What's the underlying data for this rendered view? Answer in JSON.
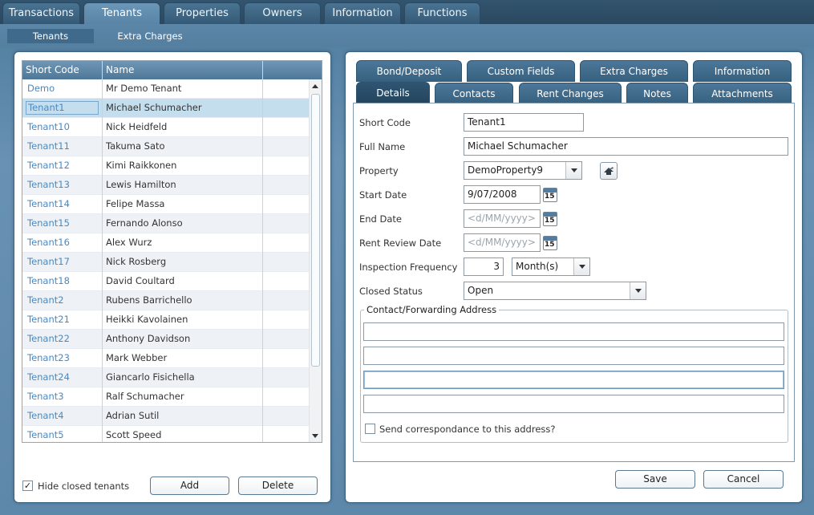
{
  "top_tabs": [
    "Transactions",
    "Tenants",
    "Properties",
    "Owners",
    "Information",
    "Functions"
  ],
  "sub_tabs": [
    "Tenants",
    "Extra Charges"
  ],
  "grid": {
    "columns": [
      "Short Code",
      "Name"
    ],
    "rows": [
      {
        "code": "Demo",
        "name": "Mr Demo Tenant"
      },
      {
        "code": "Tenant1",
        "name": "Michael Schumacher"
      },
      {
        "code": "Tenant10",
        "name": "Nick Heidfeld"
      },
      {
        "code": "Tenant11",
        "name": "Takuma Sato"
      },
      {
        "code": "Tenant12",
        "name": "Kimi Raikkonen"
      },
      {
        "code": "Tenant13",
        "name": "Lewis Hamilton"
      },
      {
        "code": "Tenant14",
        "name": "Felipe Massa"
      },
      {
        "code": "Tenant15",
        "name": "Fernando Alonso"
      },
      {
        "code": "Tenant16",
        "name": "Alex Wurz"
      },
      {
        "code": "Tenant17",
        "name": "Nick Rosberg"
      },
      {
        "code": "Tenant18",
        "name": "David Coultard"
      },
      {
        "code": "Tenant2",
        "name": "Rubens Barrichello"
      },
      {
        "code": "Tenant21",
        "name": "Heikki Kavolainen"
      },
      {
        "code": "Tenant22",
        "name": "Anthony Davidson"
      },
      {
        "code": "Tenant23",
        "name": "Mark Webber"
      },
      {
        "code": "Tenant24",
        "name": "Giancarlo Fisichella"
      },
      {
        "code": "Tenant3",
        "name": "Ralf Schumacher"
      },
      {
        "code": "Tenant4",
        "name": "Adrian Sutil"
      },
      {
        "code": "Tenant5",
        "name": "Scott Speed"
      }
    ]
  },
  "left_footer": {
    "hide_closed_label": "Hide closed tenants",
    "hide_closed_checked": true,
    "add_label": "Add",
    "delete_label": "Delete"
  },
  "detail_tabs_row1": [
    "Bond/Deposit",
    "Custom Fields",
    "Extra Charges",
    "Information"
  ],
  "detail_tabs_row2": [
    "Details",
    "Contacts",
    "Rent Changes",
    "Notes",
    "Attachments"
  ],
  "form": {
    "short_code_label": "Short Code",
    "short_code": "Tenant1",
    "full_name_label": "Full Name",
    "full_name": "Michael Schumacher",
    "property_label": "Property",
    "property": "DemoProperty9",
    "start_date_label": "Start Date",
    "start_date": "9/07/2008",
    "end_date_label": "End Date",
    "end_date_placeholder": "<d/MM/yyyy>",
    "rent_review_label": "Rent Review Date",
    "rent_review_placeholder": "<d/MM/yyyy>",
    "inspection_label": "Inspection Frequency",
    "inspection_value": "3",
    "inspection_unit": "Month(s)",
    "closed_status_label": "Closed Status",
    "closed_status": "Open",
    "calendar_day": "15",
    "address_group_label": "Contact/Forwarding Address",
    "address_lines": [
      "",
      "",
      "",
      ""
    ],
    "send_corr_label": "Send correspondance to this address?"
  },
  "buttons": {
    "save": "Save",
    "cancel": "Cancel"
  }
}
